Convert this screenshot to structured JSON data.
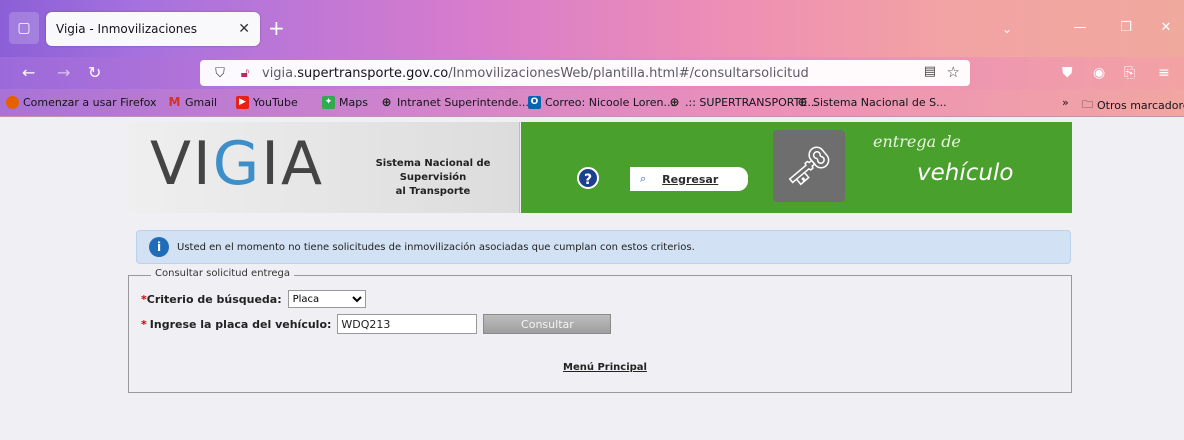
{
  "browser": {
    "tab_title": "Vigia - Inmovilizaciones",
    "url_prefix": "vigia.",
    "url_domain": "supertransporte.gov.co",
    "url_path": "/InmovilizacionesWeb/plantilla.html#/consultarsolicitud",
    "bookmarks": [
      {
        "label": "Comenzar a usar Firefox",
        "icon": "firefox-icon"
      },
      {
        "label": "Gmail",
        "icon": "gmail-icon"
      },
      {
        "label": "YouTube",
        "icon": "youtube-icon"
      },
      {
        "label": "Maps",
        "icon": "maps-icon"
      },
      {
        "label": "Intranet Superintende...",
        "icon": "globe-icon"
      },
      {
        "label": "Correo: Nicoole Loren...",
        "icon": "outlook-icon"
      },
      {
        "label": ".:: SUPERTRANSPORTE...",
        "icon": "globe-icon"
      },
      {
        "label": "Sistema Nacional de S...",
        "icon": "globe-icon"
      }
    ],
    "other_bookmarks": "Otros marcadores"
  },
  "header": {
    "logo": "VIGIA",
    "system_title_1": "Sistema Nacional de",
    "system_title_2": "Supervisión",
    "system_title_3": "al Transporte",
    "back_label": "Regresar",
    "delivery_1": "entrega de",
    "delivery_2": "vehículo"
  },
  "info_message": "Usted en el momento no tiene solicitudes de inmovilización asociadas que cumplan con estos criterios.",
  "form": {
    "legend": "Consultar solicitud entrega",
    "criteria_label": "Criterio de búsqueda:",
    "criteria_value": "Placa",
    "plate_label": "Ingrese la placa del vehículo:",
    "plate_value": "WDQ213",
    "consult_label": "Consultar",
    "main_menu": "Menú Principal"
  },
  "colors": {
    "accent_green": "#4aa02c",
    "info_blue": "#d2e1f3",
    "required_red": "#cc0000"
  }
}
